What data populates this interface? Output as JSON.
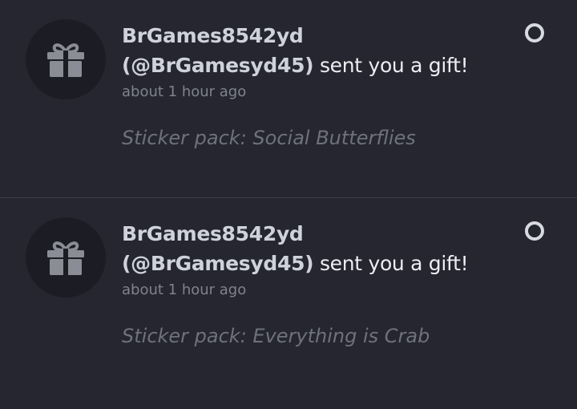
{
  "notifications": [
    {
      "username": "BrGames8542yd",
      "handle": "(@BrGamesyd45)",
      "action": " sent you a gift!",
      "time": "about 1 hour ago",
      "detail": "Sticker pack: Social Butterflies",
      "icon": "gift-icon",
      "read_toggle_icon": "circle-outline-icon"
    },
    {
      "username": "BrGames8542yd",
      "handle": "(@BrGamesyd45)",
      "action": " sent you a gift!",
      "time": "about 1 hour ago",
      "detail": "Sticker pack: Everything is Crab",
      "icon": "gift-icon",
      "read_toggle_icon": "circle-outline-icon"
    }
  ],
  "colors": {
    "background": "#25262f",
    "avatar_bg": "#1c1d24",
    "gift_icon": "#8a8c96",
    "username": "#cfd1db",
    "action_text": "#eceef3",
    "timestamp": "#80828c",
    "detail": "#6f717b",
    "divider": "#3b3d48"
  }
}
